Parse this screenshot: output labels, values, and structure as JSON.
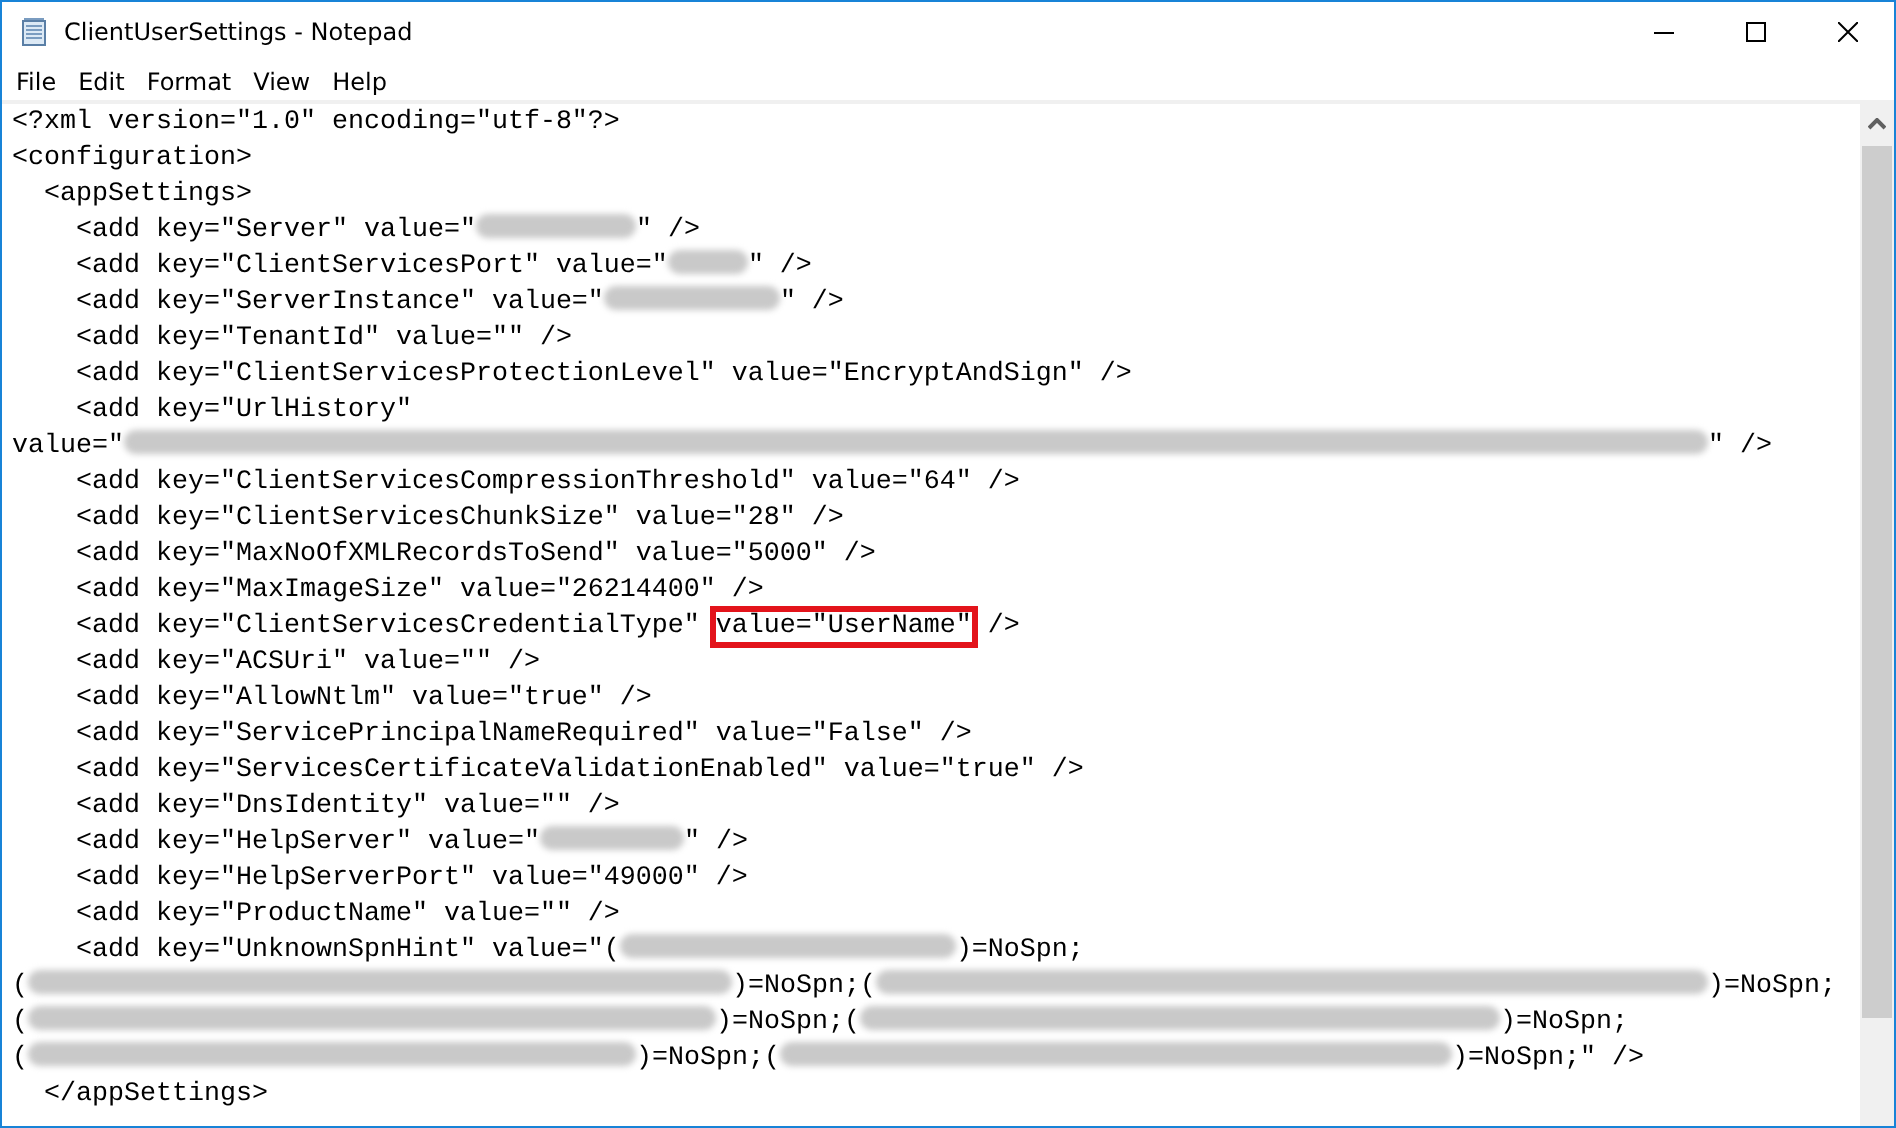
{
  "window": {
    "title": "ClientUserSettings - Notepad"
  },
  "menu": [
    "File",
    "Edit",
    "Format",
    "View",
    "Help"
  ],
  "lines": [
    {
      "segments": [
        {
          "kind": "text",
          "text": "<?xml version=\"1.0\" encoding=\"utf-8\"?>"
        }
      ]
    },
    {
      "segments": [
        {
          "kind": "text",
          "text": "<configuration>"
        }
      ]
    },
    {
      "segments": [
        {
          "kind": "text",
          "text": "  <appSettings>"
        }
      ]
    },
    {
      "segments": [
        {
          "kind": "text",
          "text": "    <add key=\"Server\" value=\""
        },
        {
          "kind": "redacted"
        },
        {
          "kind": "text",
          "text": "\" />"
        }
      ]
    },
    {
      "segments": [
        {
          "kind": "text",
          "text": "    <add key=\"ClientServicesPort\" value=\""
        },
        {
          "kind": "redacted"
        },
        {
          "kind": "text",
          "text": "\" />"
        }
      ]
    },
    {
      "segments": [
        {
          "kind": "text",
          "text": "    <add key=\"ServerInstance\" value=\""
        },
        {
          "kind": "redacted"
        },
        {
          "kind": "text",
          "text": "\" />"
        }
      ]
    },
    {
      "segments": [
        {
          "kind": "text",
          "text": "    <add key=\"TenantId\" value=\"\" />"
        }
      ]
    },
    {
      "segments": [
        {
          "kind": "text",
          "text": "    <add key=\"ClientServicesProtectionLevel\" value=\"EncryptAndSign\" />"
        }
      ]
    },
    {
      "segments": [
        {
          "kind": "text",
          "text": "    <add key=\"UrlHistory\""
        }
      ]
    },
    {
      "segments": [
        {
          "kind": "text",
          "text": "value=\""
        },
        {
          "kind": "redacted"
        },
        {
          "kind": "text",
          "text": "\" />"
        }
      ]
    },
    {
      "segments": [
        {
          "kind": "text",
          "text": "    <add key=\"ClientServicesCompressionThreshold\" value=\"64\" />"
        }
      ]
    },
    {
      "segments": [
        {
          "kind": "text",
          "text": "    <add key=\"ClientServicesChunkSize\" value=\"28\" />"
        }
      ]
    },
    {
      "segments": [
        {
          "kind": "text",
          "text": "    <add key=\"MaxNoOfXMLRecordsToSend\" value=\"5000\" />"
        }
      ]
    },
    {
      "segments": [
        {
          "kind": "text",
          "text": "    <add key=\"MaxImageSize\" value=\"26214400\" />"
        }
      ]
    },
    {
      "segments": [
        {
          "kind": "text",
          "text": "    <add key=\"ClientServicesCredentialType\" "
        },
        {
          "kind": "text",
          "text": "value=\"UserName\"",
          "boxed": true
        },
        {
          "kind": "text",
          "text": " />"
        }
      ]
    },
    {
      "segments": [
        {
          "kind": "text",
          "text": "    <add key=\"ACSUri\" value=\"\" />"
        }
      ]
    },
    {
      "segments": [
        {
          "kind": "text",
          "text": "    <add key=\"AllowNtlm\" value=\"true\" />"
        }
      ]
    },
    {
      "segments": [
        {
          "kind": "text",
          "text": "    <add key=\"ServicePrincipalNameRequired\" value=\"False\" />"
        }
      ]
    },
    {
      "segments": [
        {
          "kind": "text",
          "text": "    <add key=\"ServicesCertificateValidationEnabled\" value=\"true\" />"
        }
      ]
    },
    {
      "segments": [
        {
          "kind": "text",
          "text": "    <add key=\"DnsIdentity\" value=\"\" />"
        }
      ]
    },
    {
      "segments": [
        {
          "kind": "text",
          "text": "    <add key=\"HelpServer\" value=\""
        },
        {
          "kind": "redacted"
        },
        {
          "kind": "text",
          "text": "\" />"
        }
      ]
    },
    {
      "segments": [
        {
          "kind": "text",
          "text": "    <add key=\"HelpServerPort\" value=\"49000\" />"
        }
      ]
    },
    {
      "segments": [
        {
          "kind": "text",
          "text": "    <add key=\"ProductName\" value=\"\" />"
        }
      ]
    },
    {
      "segments": [
        {
          "kind": "text",
          "text": "    <add key=\"UnknownSpnHint\" value=\"("
        },
        {
          "kind": "redacted"
        },
        {
          "kind": "text",
          "text": ")=NoSpn;"
        }
      ]
    },
    {
      "segments": [
        {
          "kind": "text",
          "text": "("
        },
        {
          "kind": "redacted"
        },
        {
          "kind": "text",
          "text": ")=NoSpn;("
        },
        {
          "kind": "redacted"
        },
        {
          "kind": "text",
          "text": ")=NoSpn;"
        }
      ]
    },
    {
      "segments": [
        {
          "kind": "text",
          "text": "("
        },
        {
          "kind": "redacted"
        },
        {
          "kind": "text",
          "text": ")=NoSpn;("
        },
        {
          "kind": "redacted"
        },
        {
          "kind": "text",
          "text": ")=NoSpn;"
        }
      ]
    },
    {
      "segments": [
        {
          "kind": "text",
          "text": "("
        },
        {
          "kind": "redacted"
        },
        {
          "kind": "text",
          "text": ")=NoSpn;("
        },
        {
          "kind": "redacted"
        },
        {
          "kind": "text",
          "text": ")=NoSpn;\" />"
        }
      ]
    },
    {
      "segments": [
        {
          "kind": "text",
          "text": "  </appSettings>"
        }
      ]
    }
  ]
}
